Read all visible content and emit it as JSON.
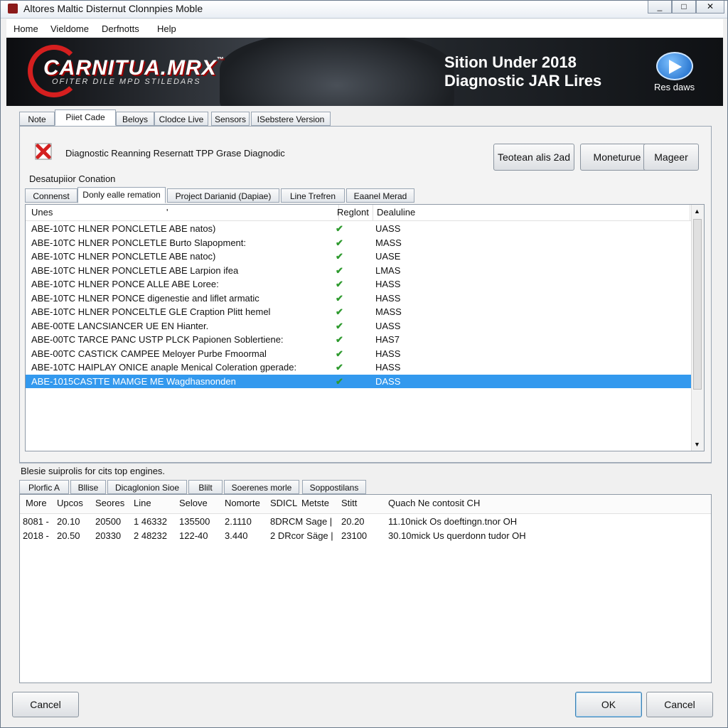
{
  "window": {
    "title": "Altores Maltic Disternut Clonnpies Moble",
    "controls": [
      "_",
      "□",
      "✕"
    ]
  },
  "menu": [
    "Home",
    "Vieldome",
    "Derfnotts",
    "Help"
  ],
  "banner": {
    "logo": "CARNITUA.MRX",
    "logo_tm": "™",
    "logo_sub": "OFITER DILE MPD STILEDARS",
    "headline_1": "Sition Under 2018",
    "headline_2": "Diagnostic JAR Lires",
    "play_label": "Res daws"
  },
  "main_tabs": [
    "Note",
    "Piiet Cade",
    "Beloys",
    "Clodce Live",
    "Sensors",
    "ISebstere Version"
  ],
  "status": {
    "icon": "error-x",
    "text": "Diagnostic Reanning Resernatt TPP Grase Diagnodic"
  },
  "action_buttons": [
    "Teotean alis 2ad",
    "Moneturue",
    "Mageer"
  ],
  "section1_label": "Desatupiior Conation",
  "sub_tabs": [
    "Connenst",
    "Donly ealle remation",
    "Project Darianid (Dapiae)",
    "Line Trefren",
    "Eaanel Merad"
  ],
  "list": {
    "headers": [
      "Unes",
      "Reglont",
      "Dealuline"
    ],
    "header_marker": "'",
    "rows": [
      {
        "code": "ABE-10TC HLNER PONCLETLE ABE natos)",
        "status": "UASS"
      },
      {
        "code": "ABE-10TC HLNER PONCLETLE Burto Slapopment:",
        "status": "MASS"
      },
      {
        "code": "ABE-10TC HLNER PONCLETLE ABE natoc)",
        "status": "UASE"
      },
      {
        "code": "ABE-10TC HLNER PONCLETLE ABE Larpion ifea",
        "status": "LMAS"
      },
      {
        "code": "ABE-10TC HLNER PONCE ALLE ABE Loree:",
        "status": "HASS"
      },
      {
        "code": "ABE-10TC HLNER PONCE  digenestie and liflet armatic",
        "status": "HASS"
      },
      {
        "code": "ABE-10TC HLNER PONCELTLE GLE Craption Plitt hemel",
        "status": "MASS"
      },
      {
        "code": "ABE-00TE LANCSIANCER UE EN Hianter.",
        "status": "UASS"
      },
      {
        "code": "ABE-00TC TARCE PANC USTP PLCK Papionen Soblertiene:",
        "status": "HAS7"
      },
      {
        "code": "ABE-00TC CASTICK CAMPEE Meloyer Purbe Fmoormal",
        "status": "HASS"
      },
      {
        "code": "ABE-10TC HAIPLAY ONICE anaple Menical Coleration gperade:",
        "status": "HASS"
      },
      {
        "code": "ABE-1015CASTTE MAMGE ME Wagdhasnonden",
        "status": "DASS"
      }
    ],
    "selected_index": 11
  },
  "section2_label": "Blesie suiprolis for cits top engines.",
  "bottom_tabs": [
    "Plorfic A",
    "Bllise",
    "Dicaglonion Sioe",
    "Blilt",
    "Soerenes morle",
    "Soppostilans"
  ],
  "bottom_table": {
    "headers": [
      "More",
      "Upcos",
      "Seores",
      "Line",
      "Selove",
      "Nomorte",
      "SDICL",
      "Metste",
      "Stitt",
      "Quach Ne contosit CH"
    ],
    "rows": [
      [
        "8081 -",
        "20.10",
        "20500",
        "1 46332",
        "135500",
        "2.1110",
        "8DRCM Sage |",
        "20.20",
        "11.10nick Os doeftingn.tnor OH"
      ],
      [
        "2018 -",
        "20.50",
        "20330",
        "2 48232",
        "122-40",
        "3.440",
        "2 DRcor Säge |",
        "23100",
        "30.10mick Us querdonn tudor OH"
      ]
    ]
  },
  "footer": {
    "cancel_left": "Cancel",
    "ok": "OK",
    "cancel_right": "Cancel"
  },
  "colors": {
    "selection": "#3399ee",
    "check": "#2e9a2e",
    "logo_red": "#d51f1f",
    "banner_bg": "#1c1f23"
  }
}
